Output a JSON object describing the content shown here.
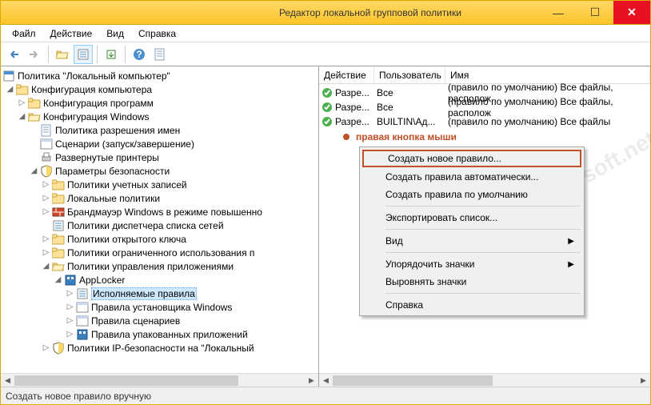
{
  "window": {
    "title": "Редактор локальной групповой политики"
  },
  "menu": {
    "file": "Файл",
    "action": "Действие",
    "view": "Вид",
    "help": "Справка"
  },
  "tree": {
    "root": "Политика \"Локальный компьютер\"",
    "n1": "Конфигурация компьютера",
    "n1a": "Конфигурация программ",
    "n1b": "Конфигурация Windows",
    "n1b1": "Политика разрешения имен",
    "n1b2": "Сценарии (запуск/завершение)",
    "n1b3": "Развернутые принтеры",
    "n1b4": "Параметры безопасности",
    "n1b4a": "Политики учетных записей",
    "n1b4b": "Локальные политики",
    "n1b4c": "Брандмауэр Windows в режиме повышенно",
    "n1b4d": "Политики диспетчера списка сетей",
    "n1b4e": "Политики открытого ключа",
    "n1b4f": "Политики ограниченного использования п",
    "n1b4g": "Политики управления приложениями",
    "n1b4g1": "AppLocker",
    "n1b4g1a": "Исполняемые правила",
    "n1b4g1b": "Правила установщика Windows",
    "n1b4g1c": "Правила сценариев",
    "n1b4g1d": "Правила упакованных приложений",
    "n1b4h": "Политики IP-безопасности на \"Локальный"
  },
  "cols": {
    "c1": "Действие",
    "c2": "Пользователь",
    "c3": "Имя"
  },
  "rows": [
    {
      "a": "Разре...",
      "u": "Все",
      "n": "(правило по умолчанию) Все файлы, располож"
    },
    {
      "a": "Разре...",
      "u": "Все",
      "n": "(правило по умолчанию) Все файлы, располож"
    },
    {
      "a": "Разре...",
      "u": "BUILTIN\\Ад...",
      "n": "(правило по умолчанию) Все файлы"
    }
  ],
  "annotation": "правая кнопка мыши",
  "ctx": {
    "m1": "Создать новое правило...",
    "m2": "Создать правила автоматически...",
    "m3": "Создать правила по умолчанию",
    "m4": "Экспортировать список...",
    "m5": "Вид",
    "m6": "Упорядочить значки",
    "m7": "Выровнять значки",
    "m8": "Справка"
  },
  "status": "Создать новое правило вручную",
  "watermark": "www.spy-soft.net"
}
